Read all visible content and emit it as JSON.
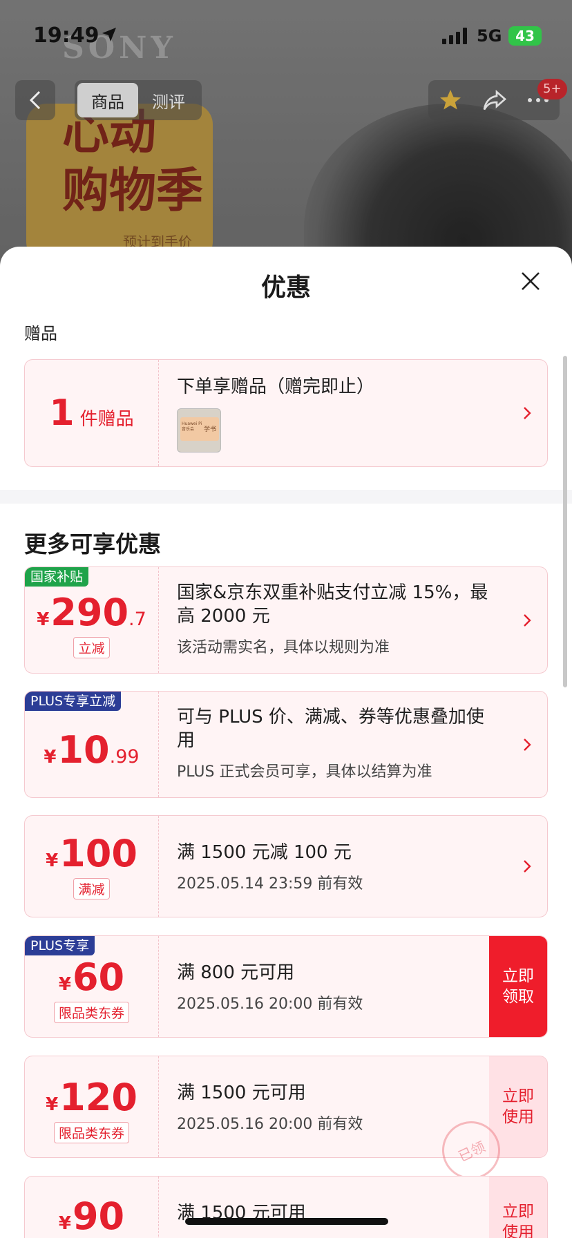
{
  "status_bar": {
    "time": "19:49",
    "network": "5G",
    "battery": "43"
  },
  "background": {
    "brand": "SONY",
    "promo_line1": "心动",
    "promo_line2": "购物季",
    "promo_sub": "预计到手价",
    "nav_tabs": [
      "商品",
      "测评"
    ],
    "cart_badge": "5+"
  },
  "sheet": {
    "title": "优惠",
    "gift_section_label": "赠品",
    "gift_card": {
      "count": "1",
      "count_unit": "件赠品",
      "title": "下单享赠品（赠完即止）",
      "thumb_text": "Huawei Pi 音乐会",
      "thumb_side": "学书"
    },
    "more_heading": "更多可享优惠",
    "offers": [
      {
        "tag": "国家补贴",
        "tag_color": "green",
        "symbol": "¥",
        "amount": "290",
        "decimal": ".7",
        "sub": "立减",
        "title": "国家&京东双重补贴支付立减 15%，最高 2000 元",
        "desc": "该活动需实名，具体以规则为准"
      },
      {
        "tag": "PLUS专享立减",
        "tag_color": "blue",
        "symbol": "¥",
        "amount": "10",
        "decimal": ".99",
        "sub": "",
        "title": "可与 PLUS 价、满减、券等优惠叠加使用",
        "desc": "PLUS 正式会员可享，具体以结算为准"
      },
      {
        "tag": "",
        "tag_color": "",
        "symbol": "¥",
        "amount": "100",
        "decimal": "",
        "sub": "满减",
        "title": "满 1500 元减 100 元",
        "desc": "2025.05.14 23:59 前有效"
      },
      {
        "tag": "PLUS专享",
        "tag_color": "blue",
        "symbol": "¥",
        "amount": "60",
        "decimal": "",
        "sub": "限品类东券",
        "title": "满 800 元可用",
        "desc": "2025.05.16 20:00 前有效",
        "cta": "立即\n领取"
      },
      {
        "tag": "",
        "tag_color": "",
        "symbol": "¥",
        "amount": "120",
        "decimal": "",
        "sub": "限品类东券",
        "title": "满 1500 元可用",
        "desc": "2025.05.16 20:00 前有效",
        "cta": "立即\n使用",
        "stamp": "已领"
      },
      {
        "tag": "",
        "tag_color": "",
        "symbol": "¥",
        "amount": "90",
        "decimal": "",
        "sub": "",
        "title": "满 1500 元可用",
        "desc": "",
        "cta": "立即\n使用"
      }
    ]
  },
  "colors": {
    "accent": "#e4202e",
    "cta_solid": "#ef1d2b",
    "tag_green": "#1fa34a",
    "tag_blue": "#2c3d96"
  }
}
